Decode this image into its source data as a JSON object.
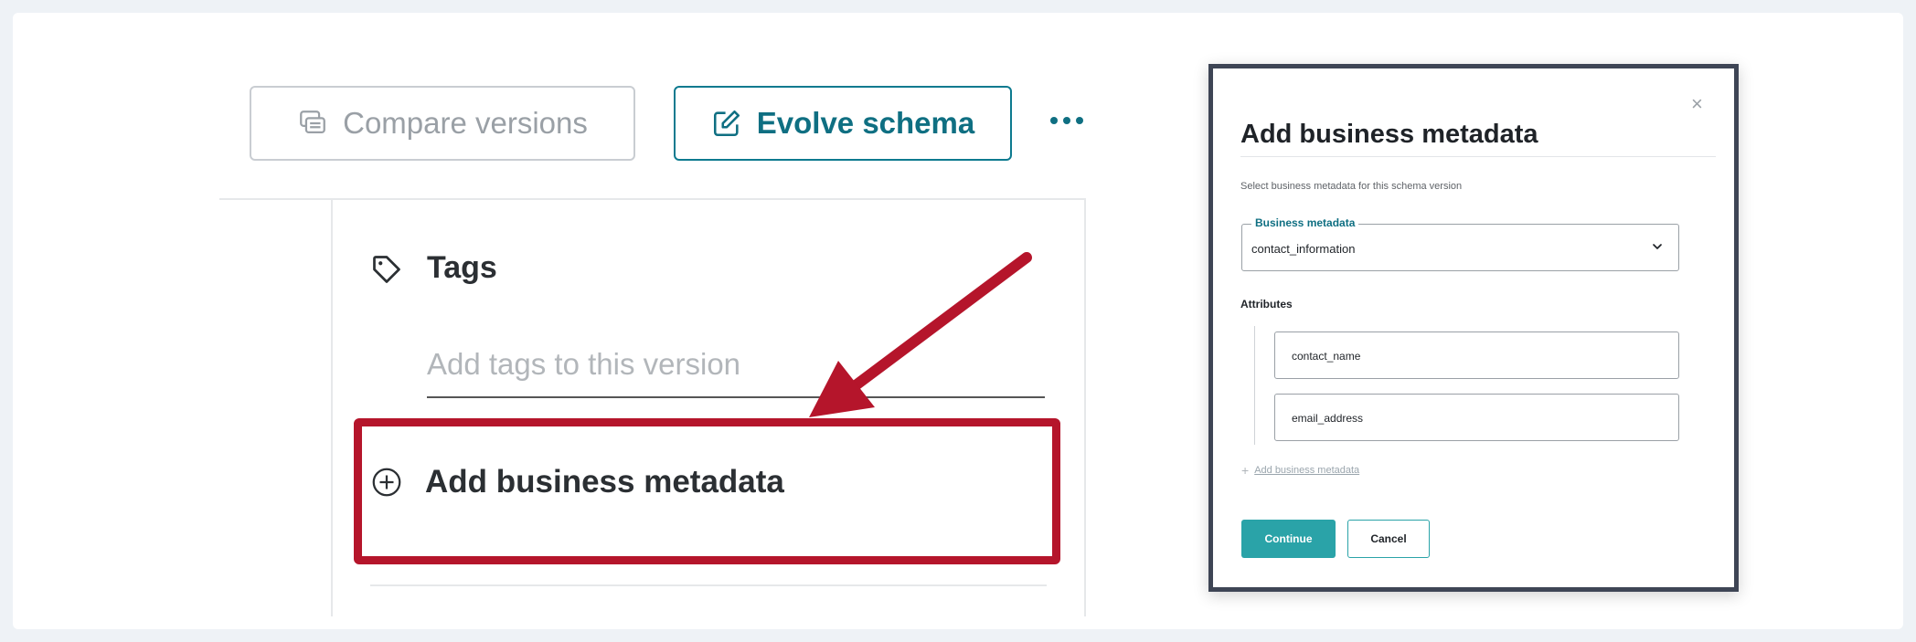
{
  "toolbar": {
    "compare_label": "Compare versions",
    "evolve_label": "Evolve schema"
  },
  "tags": {
    "title": "Tags",
    "placeholder": "Add tags to this version"
  },
  "business_metadata": {
    "add_label": "Add business metadata"
  },
  "modal": {
    "close_symbol": "×",
    "title": "Add business metadata",
    "subtitle": "Select business metadata for this schema version",
    "field_label": "Business metadata",
    "field_value": "contact_information",
    "attributes_label": "Attributes",
    "attributes": [
      "contact_name",
      "email_address"
    ],
    "add_link": "Add business metadata",
    "continue_label": "Continue",
    "cancel_label": "Cancel"
  },
  "colors": {
    "accent": "#0f6f82",
    "highlight": "#b5152b",
    "continue_bg": "#2aa3a8"
  },
  "icons": [
    "compare-icon",
    "edit-icon",
    "more-icon",
    "tag-icon",
    "plus-circle-icon",
    "close-icon",
    "chevron-down-icon",
    "arrow-annotation"
  ]
}
